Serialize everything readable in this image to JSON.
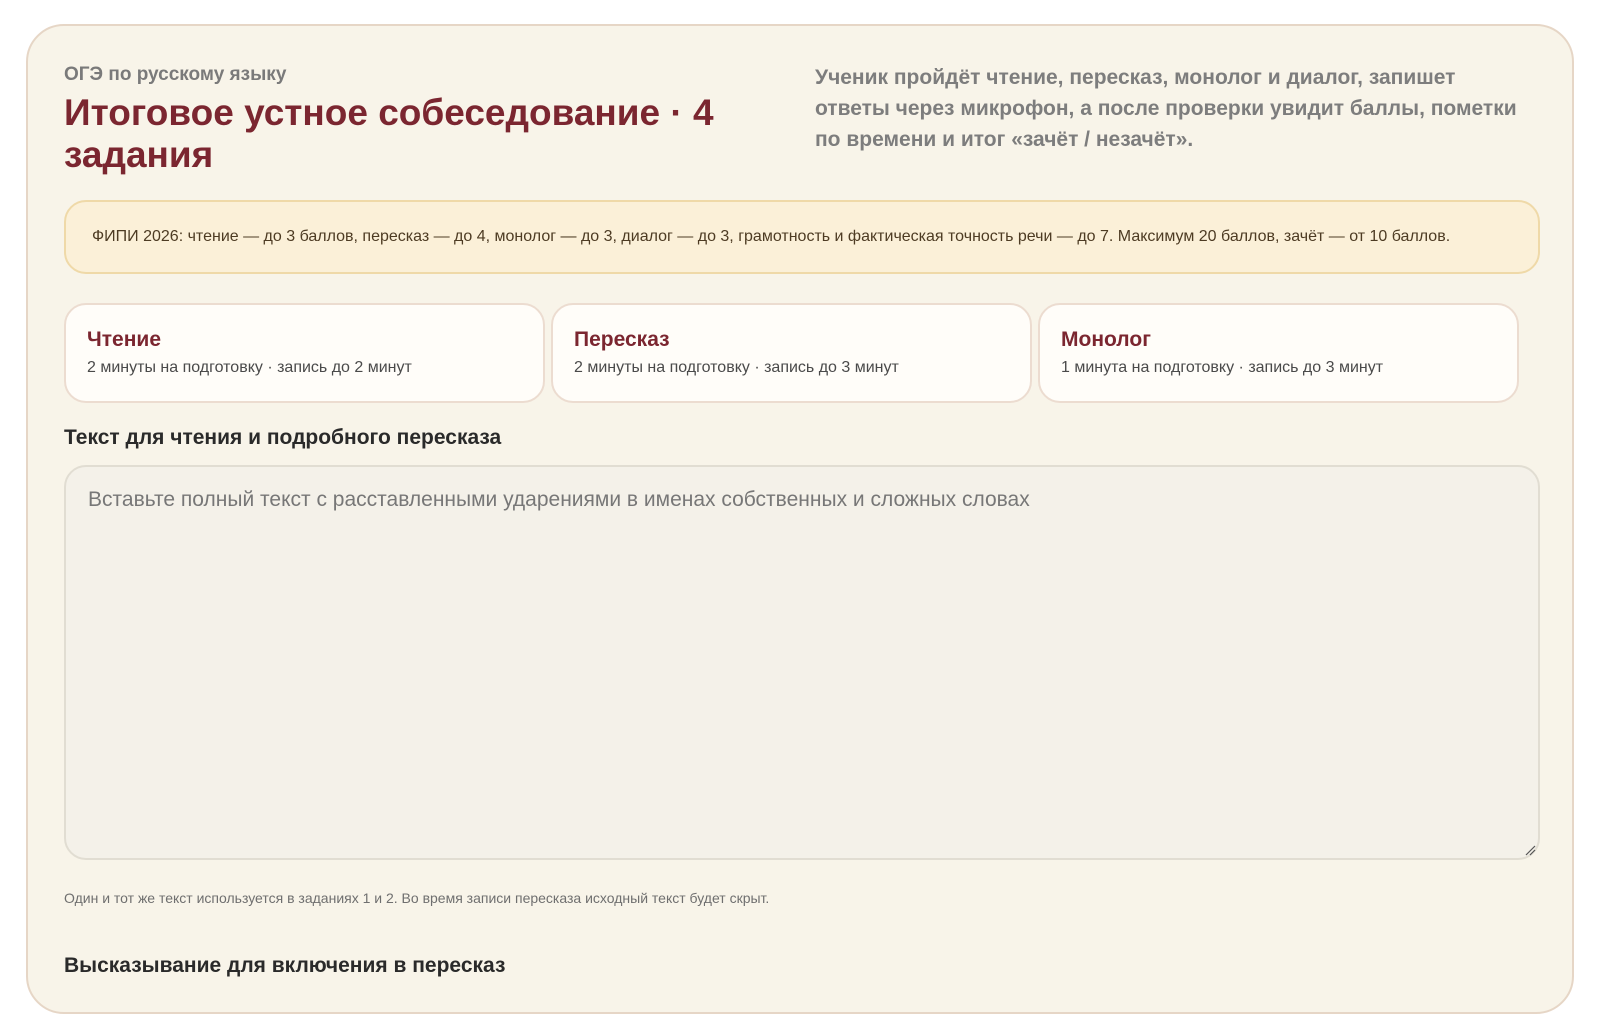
{
  "header": {
    "subject": "ОГЭ по русскому языку",
    "title": "Итоговое устное собеседование · 4 задания",
    "intro": "Ученик пройдёт чтение, пересказ, монолог и диалог, запишет ответы через микрофон, а после проверки увидит баллы, пометки по времени и итог «зачёт / незачёт»."
  },
  "notice": {
    "text": "ФИПИ 2026: чтение — до 3 баллов, пересказ — до 4, монолог — до 3, диалог — до 3, грамотность и фактическая точность речи — до 7. Максимум 20 баллов, зачёт — от 10 баллов."
  },
  "tasks": [
    {
      "title": "Чтение",
      "details": "2 минуты на подготовку · запись до 2 минут"
    },
    {
      "title": "Пересказ",
      "details": "2 минуты на подготовку · запись до 3 минут"
    },
    {
      "title": "Монолог",
      "details": "1 минута на подготовку · запись до 3 минут"
    }
  ],
  "source_text": {
    "label": "Текст для чтения и подробного пересказа",
    "placeholder": "Вставьте полный текст с расставленными ударениями в именах собственных и сложных словах",
    "value": "",
    "hint": "Один и тот же текст используется в заданиях 1 и 2. Во время записи пересказа исходный текст будет скрыт."
  },
  "next_section": {
    "label": "Высказывание для включения в пересказ"
  },
  "colors": {
    "accent": "#7b2630",
    "panel_bg": "#f8f4e9",
    "notice_bg": "#fbf0d8",
    "card_bg": "#fffdf9"
  }
}
